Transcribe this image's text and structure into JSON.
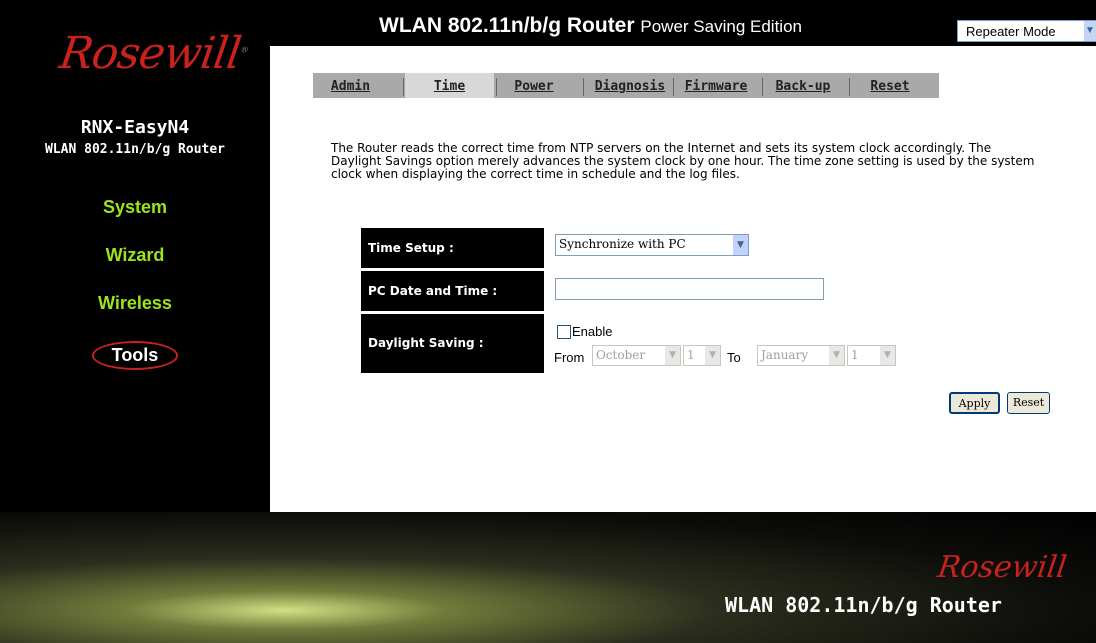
{
  "brand": {
    "logo": "Rosewill",
    "footer_logo": "Rosewill",
    "footer_text": "WLAN 802.11n/b/g Router"
  },
  "model": {
    "name": "RNX-EasyN4",
    "subtitle": "WLAN 802.11n/b/g Router"
  },
  "header": {
    "title": "WLAN 802.11n/b/g Router",
    "edition": "Power Saving Edition",
    "mode_select": "Repeater Mode"
  },
  "sidebar": {
    "items": [
      {
        "label": "System"
      },
      {
        "label": "Wizard"
      },
      {
        "label": "Wireless"
      },
      {
        "label": "Tools"
      }
    ]
  },
  "tabs": [
    {
      "label": "Admin"
    },
    {
      "label": "Time"
    },
    {
      "label": "Power"
    },
    {
      "label": "Diagnosis"
    },
    {
      "label": "Firmware"
    },
    {
      "label": "Back-up"
    },
    {
      "label": "Reset"
    }
  ],
  "active_tab": "Time",
  "description": "The Router reads the correct time from NTP servers on the Internet and sets its system clock accordingly. The Daylight Savings option merely advances the system clock by one hour. The time zone setting is used by the system clock when displaying the correct time in schedule and the log files.",
  "form": {
    "time_setup_label": "Time Setup :",
    "time_setup_value": "Synchronize with PC",
    "pc_date_label": "PC Date and Time :",
    "pc_date_value": "",
    "daylight_label": "Daylight Saving :",
    "enable_label": "Enable",
    "from_label": "From",
    "to_label": "To",
    "from_month": "October",
    "from_day": "1",
    "to_month": "January",
    "to_day": "1"
  },
  "buttons": {
    "apply": "Apply",
    "reset": "Reset"
  },
  "colors": {
    "accent_green": "#9fe21c",
    "brand_red": "#c8211e",
    "tab_bar": "#a9a9a9"
  }
}
